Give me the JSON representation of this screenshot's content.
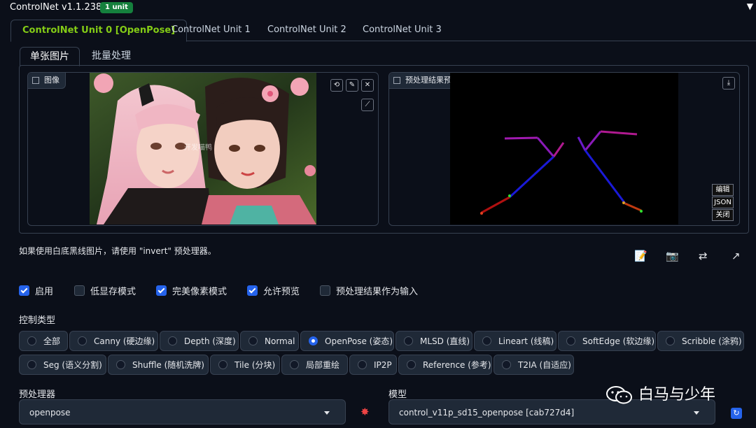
{
  "header": {
    "title": "ControlNet v1.1.238",
    "badge": "1 unit",
    "collapse_glyph": "▼"
  },
  "unit_tabs": [
    {
      "label": "ControlNet Unit 0 [OpenPose]",
      "active": true
    },
    {
      "label": "ControlNet Unit 1",
      "active": false
    },
    {
      "label": "ControlNet Unit 2",
      "active": false
    },
    {
      "label": "ControlNet Unit 3",
      "active": false
    }
  ],
  "image_tabs": [
    {
      "label": "单张图片",
      "active": true
    },
    {
      "label": "批量处理",
      "active": false
    }
  ],
  "image_panel": {
    "label": "图像",
    "image_watermark": "开发喵鸭"
  },
  "preview_panel": {
    "label": "预处理结果预览",
    "edit_label": "编辑",
    "json_label": "JSON",
    "close_label": "关闭"
  },
  "hint": "如果使用白底黑线图片，请使用 \"invert\" 预处理器。",
  "checkboxes": [
    {
      "label": "启用",
      "checked": true
    },
    {
      "label": "低显存模式",
      "checked": false
    },
    {
      "label": "完美像素模式",
      "checked": true
    },
    {
      "label": "允许预览",
      "checked": true
    },
    {
      "label": "预处理结果作为输入",
      "checked": false
    }
  ],
  "control_type": {
    "label": "控制类型",
    "options": [
      {
        "label": "全部",
        "selected": false
      },
      {
        "label": "Canny (硬边缘)",
        "selected": false
      },
      {
        "label": "Depth (深度)",
        "selected": false
      },
      {
        "label": "Normal",
        "selected": false
      },
      {
        "label": "OpenPose (姿态)",
        "selected": true
      },
      {
        "label": "MLSD (直线)",
        "selected": false
      },
      {
        "label": "Lineart (线稿)",
        "selected": false
      },
      {
        "label": "SoftEdge (软边缘)",
        "selected": false
      },
      {
        "label": "Scribble (涂鸦)",
        "selected": false
      },
      {
        "label": "Seg (语义分割)",
        "selected": false
      },
      {
        "label": "Shuffle (随机洗牌)",
        "selected": false
      },
      {
        "label": "Tile (分块)",
        "selected": false
      },
      {
        "label": "局部重绘",
        "selected": false
      },
      {
        "label": "IP2P",
        "selected": false
      },
      {
        "label": "Reference (参考)",
        "selected": false
      },
      {
        "label": "T2IA (自适应)",
        "selected": false
      }
    ]
  },
  "preprocessor": {
    "label": "预处理器",
    "value": "openpose"
  },
  "model": {
    "label": "模型",
    "value": "control_v11p_sd15_openpose [cab727d4]"
  },
  "watermark": "白马与少年",
  "colors": {
    "accent": "#2563eb",
    "tab_active": "#84cc16",
    "badge": "#15803d",
    "bg": "#0b0f19"
  }
}
